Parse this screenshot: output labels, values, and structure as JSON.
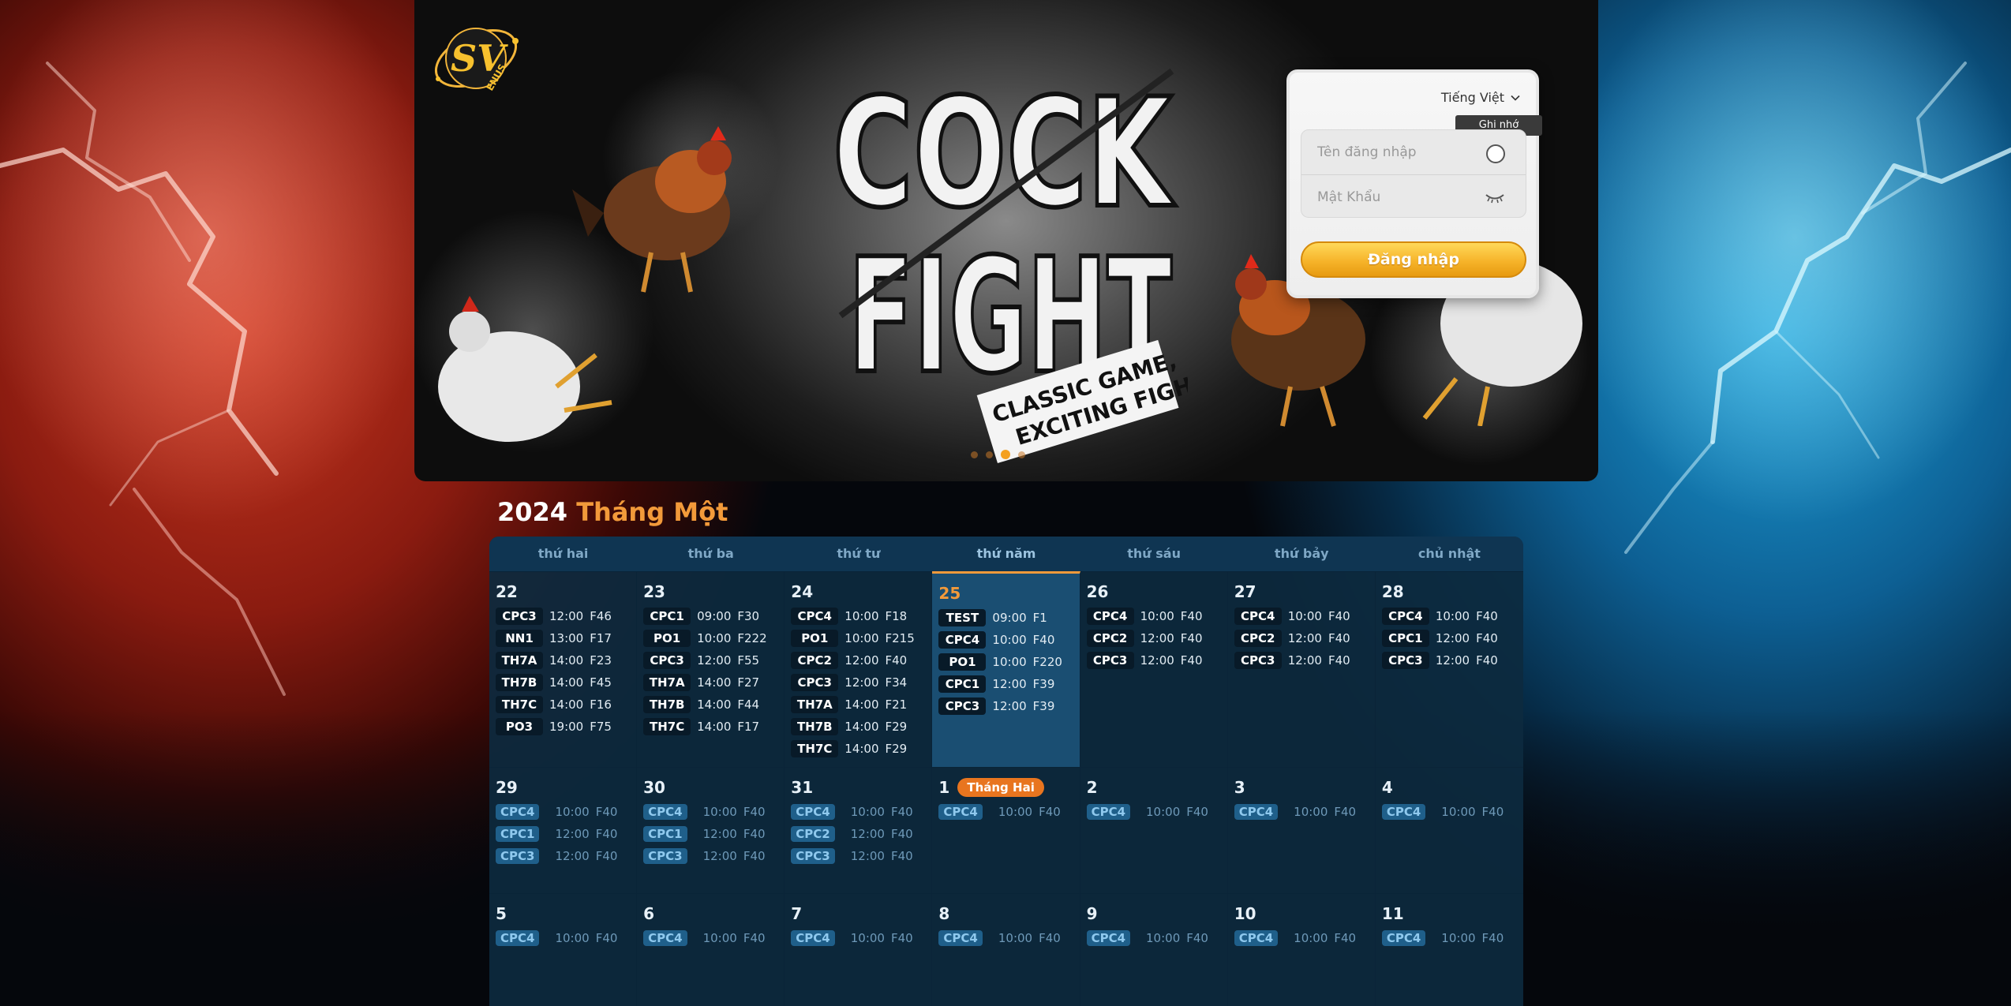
{
  "banner": {
    "logo_text": "SV ENUS",
    "title_line1": "COCK",
    "title_line2": "FIGHT",
    "tagline_line1": "CLASSIC GAME,",
    "tagline_line2": "EXCITING FIGHT!",
    "slides_count": 4,
    "active_slide": 3
  },
  "login": {
    "language": "Tiếng Việt",
    "remember_tooltip": "Ghi nhớ",
    "username_placeholder": "Tên đăng nhập",
    "password_placeholder": "Mật Khẩu",
    "submit_label": "Đăng nhập"
  },
  "calendar": {
    "year": "2024",
    "month": "Tháng Một",
    "weekdays": [
      "thứ hai",
      "thứ ba",
      "thứ tư",
      "thứ năm",
      "thứ sáu",
      "thứ bảy",
      "chủ nhật"
    ],
    "weeks": [
      [
        {
          "day": "22",
          "events": [
            [
              "CPC3",
              "12:00",
              "F46"
            ],
            [
              "NN1",
              "13:00",
              "F17"
            ],
            [
              "TH7A",
              "14:00",
              "F23"
            ],
            [
              "TH7B",
              "14:00",
              "F45"
            ],
            [
              "TH7C",
              "14:00",
              "F16"
            ],
            [
              "PO3",
              "19:00",
              "F75"
            ]
          ]
        },
        {
          "day": "23",
          "events": [
            [
              "CPC1",
              "09:00",
              "F30"
            ],
            [
              "PO1",
              "10:00",
              "F222"
            ],
            [
              "CPC3",
              "12:00",
              "F55"
            ],
            [
              "TH7A",
              "14:00",
              "F27"
            ],
            [
              "TH7B",
              "14:00",
              "F44"
            ],
            [
              "TH7C",
              "14:00",
              "F17"
            ]
          ]
        },
        {
          "day": "24",
          "events": [
            [
              "CPC4",
              "10:00",
              "F18"
            ],
            [
              "PO1",
              "10:00",
              "F215"
            ],
            [
              "CPC2",
              "12:00",
              "F40"
            ],
            [
              "CPC3",
              "12:00",
              "F34"
            ],
            [
              "TH7A",
              "14:00",
              "F21"
            ],
            [
              "TH7B",
              "14:00",
              "F29"
            ],
            [
              "TH7C",
              "14:00",
              "F29"
            ]
          ]
        },
        {
          "day": "25",
          "today": true,
          "events": [
            [
              "TEST",
              "09:00",
              "F1"
            ],
            [
              "CPC4",
              "10:00",
              "F40"
            ],
            [
              "PO1",
              "10:00",
              "F220"
            ],
            [
              "CPC1",
              "12:00",
              "F39"
            ],
            [
              "CPC3",
              "12:00",
              "F39"
            ]
          ]
        },
        {
          "day": "26",
          "events": [
            [
              "CPC4",
              "10:00",
              "F40"
            ],
            [
              "CPC2",
              "12:00",
              "F40"
            ],
            [
              "CPC3",
              "12:00",
              "F40"
            ]
          ]
        },
        {
          "day": "27",
          "events": [
            [
              "CPC4",
              "10:00",
              "F40"
            ],
            [
              "CPC2",
              "12:00",
              "F40"
            ],
            [
              "CPC3",
              "12:00",
              "F40"
            ]
          ]
        },
        {
          "day": "28",
          "events": [
            [
              "CPC4",
              "10:00",
              "F40"
            ],
            [
              "CPC1",
              "12:00",
              "F40"
            ],
            [
              "CPC3",
              "12:00",
              "F40"
            ]
          ]
        }
      ],
      [
        {
          "day": "29",
          "events": [
            [
              "CPC4",
              "10:00",
              "F40"
            ],
            [
              "CPC1",
              "12:00",
              "F40"
            ],
            [
              "CPC3",
              "12:00",
              "F40"
            ]
          ]
        },
        {
          "day": "30",
          "events": [
            [
              "CPC4",
              "10:00",
              "F40"
            ],
            [
              "CPC1",
              "12:00",
              "F40"
            ],
            [
              "CPC3",
              "12:00",
              "F40"
            ]
          ]
        },
        {
          "day": "31",
          "events": [
            [
              "CPC4",
              "10:00",
              "F40"
            ],
            [
              "CPC2",
              "12:00",
              "F40"
            ],
            [
              "CPC3",
              "12:00",
              "F40"
            ]
          ]
        },
        {
          "day": "1",
          "badge": "Tháng Hai",
          "events": [
            [
              "CPC4",
              "10:00",
              "F40"
            ]
          ]
        },
        {
          "day": "2",
          "events": [
            [
              "CPC4",
              "10:00",
              "F40"
            ]
          ]
        },
        {
          "day": "3",
          "events": [
            [
              "CPC4",
              "10:00",
              "F40"
            ]
          ]
        },
        {
          "day": "4",
          "events": [
            [
              "CPC4",
              "10:00",
              "F40"
            ]
          ]
        }
      ],
      [
        {
          "day": "5",
          "events": [
            [
              "CPC4",
              "10:00",
              "F40"
            ]
          ]
        },
        {
          "day": "6",
          "events": [
            [
              "CPC4",
              "10:00",
              "F40"
            ]
          ]
        },
        {
          "day": "7",
          "events": [
            [
              "CPC4",
              "10:00",
              "F40"
            ]
          ]
        },
        {
          "day": "8",
          "events": [
            [
              "CPC4",
              "10:00",
              "F40"
            ]
          ]
        },
        {
          "day": "9",
          "events": [
            [
              "CPC4",
              "10:00",
              "F40"
            ]
          ]
        },
        {
          "day": "10",
          "events": [
            [
              "CPC4",
              "10:00",
              "F40"
            ]
          ]
        },
        {
          "day": "11",
          "events": [
            [
              "CPC4",
              "10:00",
              "F40"
            ]
          ]
        }
      ]
    ]
  },
  "colors": {
    "accent": "#f29a3a",
    "calendar_bg": "#0d2a3f",
    "login_button": "#f6b42a",
    "future_event_code": "#1f5f8a"
  },
  "icons": {
    "language_toggle": "chevron-down-icon",
    "password_toggle": "eye-closed-icon",
    "remember": "radio-icon"
  }
}
